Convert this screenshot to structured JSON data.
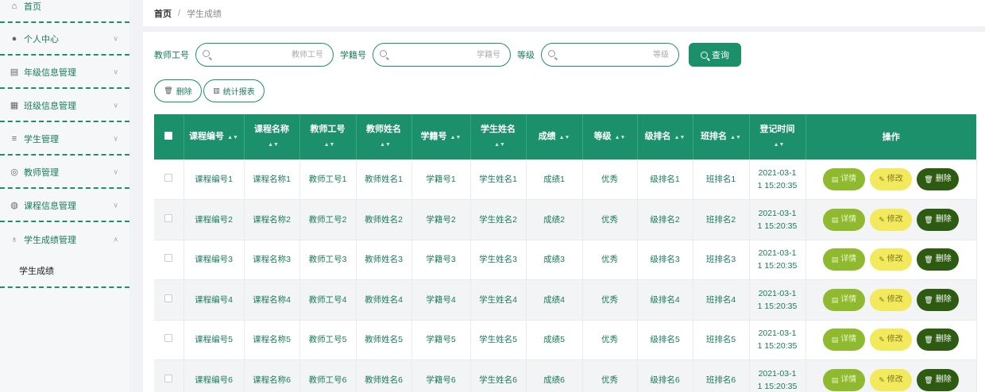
{
  "sidebar": {
    "home": "首页",
    "items": [
      {
        "label": "个人中心"
      },
      {
        "label": "年级信息管理"
      },
      {
        "label": "班级信息管理"
      },
      {
        "label": "学生管理"
      },
      {
        "label": "教师管理"
      },
      {
        "label": "课程信息管理"
      },
      {
        "label": "学生成绩管理"
      }
    ],
    "submenu": "学生成绩"
  },
  "breadcrumb": {
    "home": "首页",
    "sep": "/",
    "current": "学生成绩"
  },
  "search": {
    "teacher_id_label": "教师工号",
    "teacher_id_placeholder": "教师工号",
    "student_id_label": "学籍号",
    "student_id_placeholder": "学籍号",
    "grade_label": "等级",
    "grade_placeholder": "等级",
    "button": "查询"
  },
  "actions": {
    "delete": "删除",
    "report": "统计报表"
  },
  "table": {
    "headers": {
      "course_code": "课程编号",
      "course_name": "课程名称",
      "teacher_id": "教师工号",
      "teacher_name": "教师姓名",
      "student_id": "学籍号",
      "student_name": "学生姓名",
      "score": "成绩",
      "level": "等级",
      "grade_rank": "级排名",
      "class_rank": "班排名",
      "time": "登记时间",
      "ops": "操作"
    },
    "rows": [
      {
        "course_code": "课程编号1",
        "course_name": "课程名称1",
        "teacher_id": "教师工号1",
        "teacher_name": "教师姓名1",
        "student_id": "学籍号1",
        "student_name": "学生姓名1",
        "score": "成绩1",
        "level": "优秀",
        "grade_rank": "级排名1",
        "class_rank": "班排名1",
        "time_a": "2021-03-1",
        "time_b": "1 15:20:35"
      },
      {
        "course_code": "课程编号2",
        "course_name": "课程名称2",
        "teacher_id": "教师工号2",
        "teacher_name": "教师姓名2",
        "student_id": "学籍号2",
        "student_name": "学生姓名2",
        "score": "成绩2",
        "level": "优秀",
        "grade_rank": "级排名2",
        "class_rank": "班排名2",
        "time_a": "2021-03-1",
        "time_b": "1 15:20:35"
      },
      {
        "course_code": "课程编号3",
        "course_name": "课程名称3",
        "teacher_id": "教师工号3",
        "teacher_name": "教师姓名3",
        "student_id": "学籍号3",
        "student_name": "学生姓名3",
        "score": "成绩3",
        "level": "优秀",
        "grade_rank": "级排名3",
        "class_rank": "班排名3",
        "time_a": "2021-03-1",
        "time_b": "1 15:20:35"
      },
      {
        "course_code": "课程编号4",
        "course_name": "课程名称4",
        "teacher_id": "教师工号4",
        "teacher_name": "教师姓名4",
        "student_id": "学籍号4",
        "student_name": "学生姓名4",
        "score": "成绩4",
        "level": "优秀",
        "grade_rank": "级排名4",
        "class_rank": "班排名4",
        "time_a": "2021-03-1",
        "time_b": "1 15:20:35"
      },
      {
        "course_code": "课程编号5",
        "course_name": "课程名称5",
        "teacher_id": "教师工号5",
        "teacher_name": "教师姓名5",
        "student_id": "学籍号5",
        "student_name": "学生姓名5",
        "score": "成绩5",
        "level": "优秀",
        "grade_rank": "级排名5",
        "class_rank": "班排名5",
        "time_a": "2021-03-1",
        "time_b": "1 15:20:35"
      },
      {
        "course_code": "课程编号6",
        "course_name": "课程名称6",
        "teacher_id": "教师工号6",
        "teacher_name": "教师姓名6",
        "student_id": "学籍号6",
        "student_name": "学生姓名6",
        "score": "成绩6",
        "level": "优秀",
        "grade_rank": "级排名6",
        "class_rank": "班排名6",
        "time_a": "2021-03-1",
        "time_b": "1 15:20:35"
      }
    ],
    "row_ops": {
      "detail": "详情",
      "edit": "修改",
      "delete": "删除"
    }
  },
  "colors": {
    "primary": "#1c8f6b",
    "detail": "#8fba2f",
    "edit": "#f2e95c",
    "delete": "#2e5b12"
  }
}
